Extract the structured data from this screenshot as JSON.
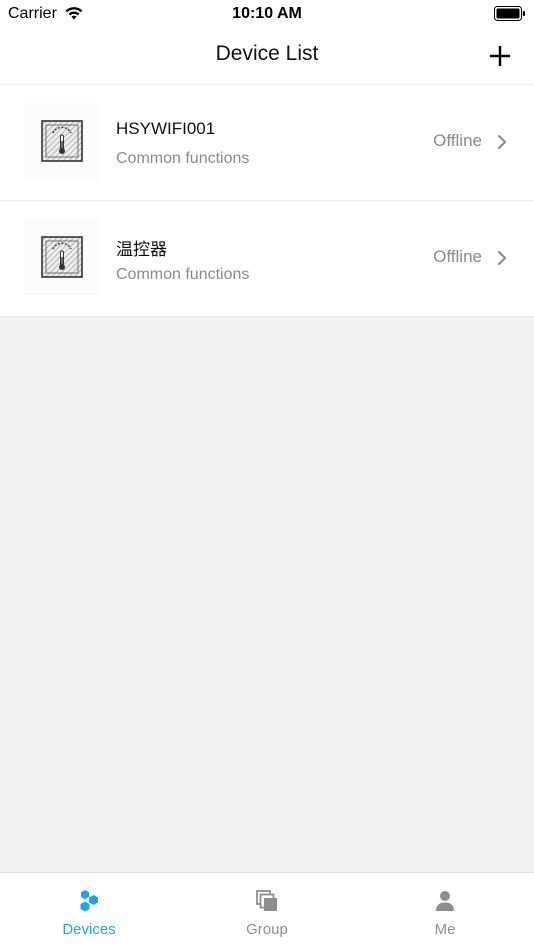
{
  "status_bar": {
    "carrier": "Carrier",
    "time": "10:10 AM"
  },
  "nav": {
    "title": "Device List",
    "add_icon": "plus-icon"
  },
  "devices": [
    {
      "name": "HSYWIFI001",
      "subtitle": "Common functions",
      "status": "Offline",
      "icon": "thermostat-icon"
    },
    {
      "name": "温控器",
      "subtitle": "Common functions",
      "status": "Offline",
      "icon": "thermostat-icon"
    }
  ],
  "tabs": [
    {
      "label": "Devices",
      "icon": "devices-icon",
      "active": true
    },
    {
      "label": "Group",
      "icon": "group-icon",
      "active": false
    },
    {
      "label": "Me",
      "icon": "person-icon",
      "active": false
    }
  ],
  "colors": {
    "accent": "#1aa6e8",
    "inactive": "#8e8e8e",
    "secondary_text": "#8a8a8a",
    "background": "#f3f3f3"
  }
}
